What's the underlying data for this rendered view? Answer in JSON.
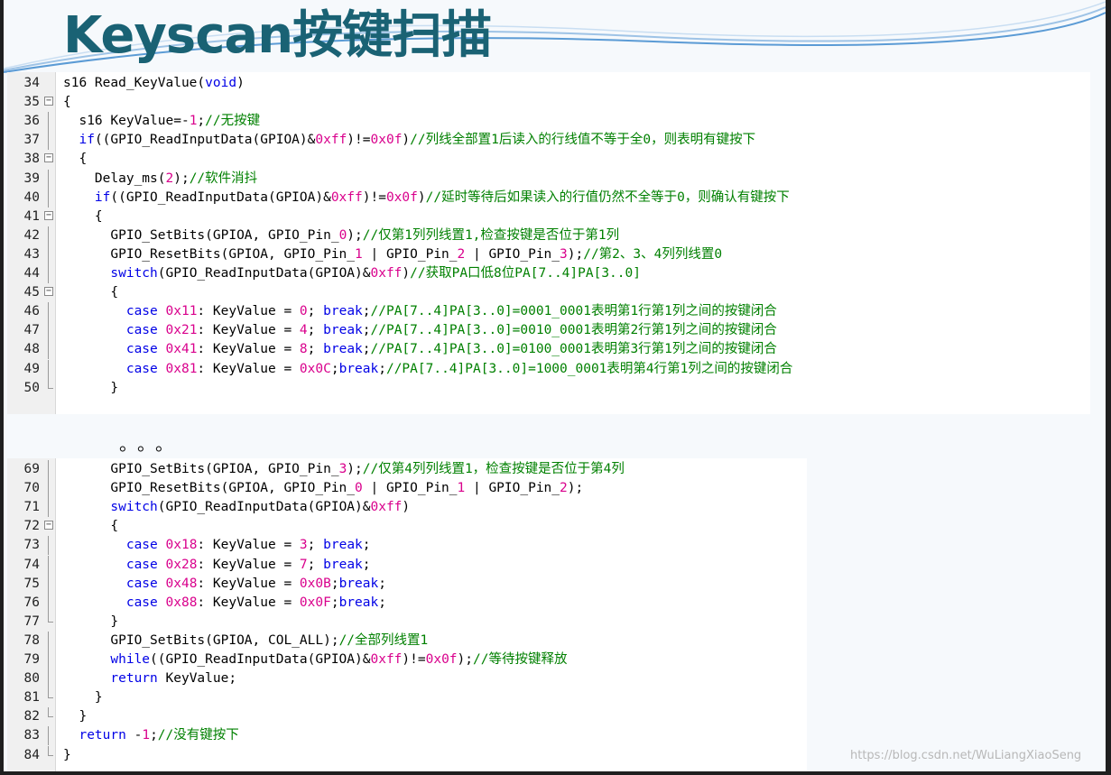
{
  "slide": {
    "title": "Keyscan按键扫描",
    "ellipsis": "。。。",
    "watermark": "https://blog.csdn.net/WuLiangXiaoSeng"
  },
  "colors": {
    "title": "#1a6274",
    "keyword": "#0000e6",
    "number": "#d9008c",
    "comment": "#008000"
  },
  "code_top": [
    {
      "n": "34",
      "fold": "",
      "indent": "",
      "tokens": [
        {
          "t": "s16 Read_KeyValue",
          "c": "tx"
        },
        {
          "t": "(",
          "c": "tx"
        },
        {
          "t": "void",
          "c": "kw"
        },
        {
          "t": ")",
          "c": "tx"
        }
      ]
    },
    {
      "n": "35",
      "fold": "box",
      "indent": "",
      "tokens": [
        {
          "t": "{",
          "c": "tx"
        }
      ]
    },
    {
      "n": "36",
      "fold": "line",
      "indent": "  ",
      "tokens": [
        {
          "t": "s16 KeyValue=-",
          "c": "tx"
        },
        {
          "t": "1",
          "c": "num"
        },
        {
          "t": ";",
          "c": "tx"
        },
        {
          "t": "//无按键",
          "c": "cm"
        }
      ]
    },
    {
      "n": "37",
      "fold": "line",
      "indent": "  ",
      "tokens": [
        {
          "t": "if",
          "c": "kw"
        },
        {
          "t": "((GPIO_ReadInputData(GPIOA)&",
          "c": "tx"
        },
        {
          "t": "0xff",
          "c": "num"
        },
        {
          "t": ")!=",
          "c": "tx"
        },
        {
          "t": "0x0f",
          "c": "num"
        },
        {
          "t": ")",
          "c": "tx"
        },
        {
          "t": "//列线全部置1后读入的行线值不等于全0，则表明有键按下",
          "c": "cm"
        }
      ]
    },
    {
      "n": "38",
      "fold": "box",
      "indent": "  ",
      "tokens": [
        {
          "t": "{",
          "c": "tx"
        }
      ]
    },
    {
      "n": "39",
      "fold": "line",
      "indent": "    ",
      "tokens": [
        {
          "t": "Delay_ms(",
          "c": "tx"
        },
        {
          "t": "2",
          "c": "num"
        },
        {
          "t": ");",
          "c": "tx"
        },
        {
          "t": "//软件消抖",
          "c": "cm"
        }
      ]
    },
    {
      "n": "40",
      "fold": "line",
      "indent": "    ",
      "tokens": [
        {
          "t": "if",
          "c": "kw"
        },
        {
          "t": "((GPIO_ReadInputData(GPIOA)&",
          "c": "tx"
        },
        {
          "t": "0xff",
          "c": "num"
        },
        {
          "t": ")!=",
          "c": "tx"
        },
        {
          "t": "0x0f",
          "c": "num"
        },
        {
          "t": ")",
          "c": "tx"
        },
        {
          "t": "//延时等待后如果读入的行值仍然不全等于0，则确认有键按下",
          "c": "cm"
        }
      ]
    },
    {
      "n": "41",
      "fold": "box",
      "indent": "    ",
      "tokens": [
        {
          "t": "{",
          "c": "tx"
        }
      ]
    },
    {
      "n": "42",
      "fold": "line",
      "indent": "      ",
      "tokens": [
        {
          "t": "GPIO_SetBits(GPIOA, GPIO_Pin_",
          "c": "tx"
        },
        {
          "t": "0",
          "c": "num"
        },
        {
          "t": ");",
          "c": "tx"
        },
        {
          "t": "//仅第1列列线置1,检查按键是否位于第1列",
          "c": "cm"
        }
      ]
    },
    {
      "n": "43",
      "fold": "line",
      "indent": "      ",
      "tokens": [
        {
          "t": "GPIO_ResetBits(GPIOA, GPIO_Pin_",
          "c": "tx"
        },
        {
          "t": "1",
          "c": "num"
        },
        {
          "t": " | GPIO_Pin_",
          "c": "tx"
        },
        {
          "t": "2",
          "c": "num"
        },
        {
          "t": " | GPIO_Pin_",
          "c": "tx"
        },
        {
          "t": "3",
          "c": "num"
        },
        {
          "t": ");",
          "c": "tx"
        },
        {
          "t": "//第2、3、4列列线置0",
          "c": "cm"
        }
      ]
    },
    {
      "n": "44",
      "fold": "line",
      "indent": "      ",
      "tokens": [
        {
          "t": "switch",
          "c": "kw"
        },
        {
          "t": "(GPIO_ReadInputData(GPIOA)&",
          "c": "tx"
        },
        {
          "t": "0xff",
          "c": "num"
        },
        {
          "t": ")",
          "c": "tx"
        },
        {
          "t": "//获取PA口低8位PA[7..4]PA[3..0]",
          "c": "cm"
        }
      ]
    },
    {
      "n": "45",
      "fold": "box",
      "indent": "      ",
      "tokens": [
        {
          "t": "{",
          "c": "tx"
        }
      ]
    },
    {
      "n": "46",
      "fold": "line",
      "indent": "        ",
      "tokens": [
        {
          "t": "case",
          "c": "kw"
        },
        {
          "t": " ",
          "c": "tx"
        },
        {
          "t": "0x11",
          "c": "num"
        },
        {
          "t": ": KeyValue = ",
          "c": "tx"
        },
        {
          "t": "0",
          "c": "num"
        },
        {
          "t": "; ",
          "c": "tx"
        },
        {
          "t": "break",
          "c": "kw"
        },
        {
          "t": ";",
          "c": "tx"
        },
        {
          "t": "//PA[7..4]PA[3..0]=0001_0001表明第1行第1列之间的按键闭合",
          "c": "cm"
        }
      ]
    },
    {
      "n": "47",
      "fold": "line",
      "indent": "        ",
      "tokens": [
        {
          "t": "case",
          "c": "kw"
        },
        {
          "t": " ",
          "c": "tx"
        },
        {
          "t": "0x21",
          "c": "num"
        },
        {
          "t": ": KeyValue = ",
          "c": "tx"
        },
        {
          "t": "4",
          "c": "num"
        },
        {
          "t": "; ",
          "c": "tx"
        },
        {
          "t": "break",
          "c": "kw"
        },
        {
          "t": ";",
          "c": "tx"
        },
        {
          "t": "//PA[7..4]PA[3..0]=0010_0001表明第2行第1列之间的按键闭合",
          "c": "cm"
        }
      ]
    },
    {
      "n": "48",
      "fold": "line",
      "indent": "        ",
      "tokens": [
        {
          "t": "case",
          "c": "kw"
        },
        {
          "t": " ",
          "c": "tx"
        },
        {
          "t": "0x41",
          "c": "num"
        },
        {
          "t": ": KeyValue = ",
          "c": "tx"
        },
        {
          "t": "8",
          "c": "num"
        },
        {
          "t": "; ",
          "c": "tx"
        },
        {
          "t": "break",
          "c": "kw"
        },
        {
          "t": ";",
          "c": "tx"
        },
        {
          "t": "//PA[7..4]PA[3..0]=0100_0001表明第3行第1列之间的按键闭合",
          "c": "cm"
        }
      ]
    },
    {
      "n": "49",
      "fold": "line",
      "indent": "        ",
      "tokens": [
        {
          "t": "case",
          "c": "kw"
        },
        {
          "t": " ",
          "c": "tx"
        },
        {
          "t": "0x81",
          "c": "num"
        },
        {
          "t": ": KeyValue = ",
          "c": "tx"
        },
        {
          "t": "0x0C",
          "c": "num"
        },
        {
          "t": ";",
          "c": "tx"
        },
        {
          "t": "break",
          "c": "kw"
        },
        {
          "t": ";",
          "c": "tx"
        },
        {
          "t": "//PA[7..4]PA[3..0]=1000_0001表明第4行第1列之间的按键闭合",
          "c": "cm"
        }
      ]
    },
    {
      "n": "50",
      "fold": "end",
      "indent": "      ",
      "tokens": [
        {
          "t": "}",
          "c": "tx"
        }
      ]
    }
  ],
  "code_bottom": [
    {
      "n": "69",
      "fold": "line",
      "indent": "      ",
      "tokens": [
        {
          "t": "GPIO_SetBits(GPIOA, GPIO_Pin_",
          "c": "tx"
        },
        {
          "t": "3",
          "c": "num"
        },
        {
          "t": ");",
          "c": "tx"
        },
        {
          "t": "//仅第4列列线置1，检查按键是否位于第4列",
          "c": "cm"
        }
      ]
    },
    {
      "n": "70",
      "fold": "line",
      "indent": "      ",
      "tokens": [
        {
          "t": "GPIO_ResetBits(GPIOA, GPIO_Pin_",
          "c": "tx"
        },
        {
          "t": "0",
          "c": "num"
        },
        {
          "t": " | GPIO_Pin_",
          "c": "tx"
        },
        {
          "t": "1",
          "c": "num"
        },
        {
          "t": " | GPIO_Pin_",
          "c": "tx"
        },
        {
          "t": "2",
          "c": "num"
        },
        {
          "t": ");",
          "c": "tx"
        }
      ]
    },
    {
      "n": "71",
      "fold": "line",
      "indent": "      ",
      "tokens": [
        {
          "t": "switch",
          "c": "kw"
        },
        {
          "t": "(GPIO_ReadInputData(GPIOA)&",
          "c": "tx"
        },
        {
          "t": "0xff",
          "c": "num"
        },
        {
          "t": ")",
          "c": "tx"
        }
      ]
    },
    {
      "n": "72",
      "fold": "box",
      "indent": "      ",
      "tokens": [
        {
          "t": "{",
          "c": "tx"
        }
      ]
    },
    {
      "n": "73",
      "fold": "line",
      "indent": "        ",
      "tokens": [
        {
          "t": "case",
          "c": "kw"
        },
        {
          "t": " ",
          "c": "tx"
        },
        {
          "t": "0x18",
          "c": "num"
        },
        {
          "t": ": KeyValue = ",
          "c": "tx"
        },
        {
          "t": "3",
          "c": "num"
        },
        {
          "t": "; ",
          "c": "tx"
        },
        {
          "t": "break",
          "c": "kw"
        },
        {
          "t": ";",
          "c": "tx"
        }
      ]
    },
    {
      "n": "74",
      "fold": "line",
      "indent": "        ",
      "tokens": [
        {
          "t": "case",
          "c": "kw"
        },
        {
          "t": " ",
          "c": "tx"
        },
        {
          "t": "0x28",
          "c": "num"
        },
        {
          "t": ": KeyValue = ",
          "c": "tx"
        },
        {
          "t": "7",
          "c": "num"
        },
        {
          "t": "; ",
          "c": "tx"
        },
        {
          "t": "break",
          "c": "kw"
        },
        {
          "t": ";",
          "c": "tx"
        }
      ]
    },
    {
      "n": "75",
      "fold": "line",
      "indent": "        ",
      "tokens": [
        {
          "t": "case",
          "c": "kw"
        },
        {
          "t": " ",
          "c": "tx"
        },
        {
          "t": "0x48",
          "c": "num"
        },
        {
          "t": ": KeyValue = ",
          "c": "tx"
        },
        {
          "t": "0x0B",
          "c": "num"
        },
        {
          "t": ";",
          "c": "tx"
        },
        {
          "t": "break",
          "c": "kw"
        },
        {
          "t": ";",
          "c": "tx"
        }
      ]
    },
    {
      "n": "76",
      "fold": "line",
      "indent": "        ",
      "tokens": [
        {
          "t": "case",
          "c": "kw"
        },
        {
          "t": " ",
          "c": "tx"
        },
        {
          "t": "0x88",
          "c": "num"
        },
        {
          "t": ": KeyValue = ",
          "c": "tx"
        },
        {
          "t": "0x0F",
          "c": "num"
        },
        {
          "t": ";",
          "c": "tx"
        },
        {
          "t": "break",
          "c": "kw"
        },
        {
          "t": ";",
          "c": "tx"
        }
      ]
    },
    {
      "n": "77",
      "fold": "end",
      "indent": "      ",
      "tokens": [
        {
          "t": "}",
          "c": "tx"
        }
      ]
    },
    {
      "n": "78",
      "fold": "line",
      "indent": "      ",
      "tokens": [
        {
          "t": "GPIO_SetBits(GPIOA, COL_ALL);",
          "c": "tx"
        },
        {
          "t": "//全部列线置1",
          "c": "cm"
        }
      ]
    },
    {
      "n": "79",
      "fold": "line",
      "indent": "      ",
      "tokens": [
        {
          "t": "while",
          "c": "kw"
        },
        {
          "t": "((GPIO_ReadInputData(GPIOA)&",
          "c": "tx"
        },
        {
          "t": "0xff",
          "c": "num"
        },
        {
          "t": ")!=",
          "c": "tx"
        },
        {
          "t": "0x0f",
          "c": "num"
        },
        {
          "t": ");",
          "c": "tx"
        },
        {
          "t": "//等待按键释放",
          "c": "cm"
        }
      ]
    },
    {
      "n": "80",
      "fold": "line",
      "indent": "      ",
      "tokens": [
        {
          "t": "return",
          "c": "kw"
        },
        {
          "t": " KeyValue;",
          "c": "tx"
        }
      ]
    },
    {
      "n": "81",
      "fold": "end",
      "indent": "    ",
      "tokens": [
        {
          "t": "}",
          "c": "tx"
        }
      ]
    },
    {
      "n": "82",
      "fold": "end",
      "indent": "  ",
      "tokens": [
        {
          "t": "}",
          "c": "tx"
        }
      ]
    },
    {
      "n": "83",
      "fold": "line",
      "indent": "  ",
      "tokens": [
        {
          "t": "return",
          "c": "kw"
        },
        {
          "t": " -",
          "c": "tx"
        },
        {
          "t": "1",
          "c": "num"
        },
        {
          "t": ";",
          "c": "tx"
        },
        {
          "t": "//没有键按下",
          "c": "cm"
        }
      ]
    },
    {
      "n": "84",
      "fold": "end",
      "indent": "",
      "tokens": [
        {
          "t": "}",
          "c": "tx"
        }
      ]
    }
  ]
}
